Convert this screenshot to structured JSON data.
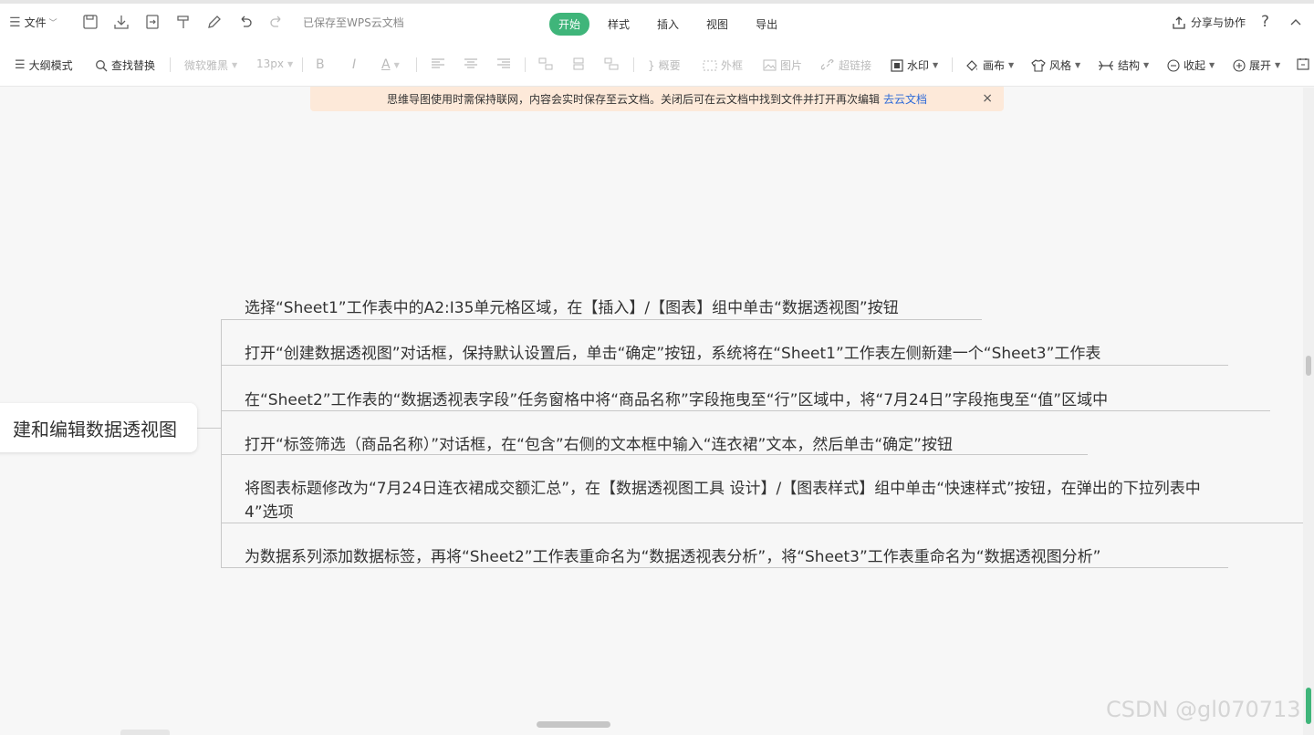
{
  "topbar": {
    "file_label": "文件",
    "saved_status": "已保存至WPS云文档",
    "tabs": [
      {
        "label": "开始",
        "active": true
      },
      {
        "label": "样式",
        "active": false
      },
      {
        "label": "插入",
        "active": false
      },
      {
        "label": "视图",
        "active": false
      },
      {
        "label": "导出",
        "active": false
      }
    ],
    "share_label": "分享与协作",
    "help_symbol": "?"
  },
  "toolbar": {
    "outline_mode": "大纲模式",
    "find_replace": "查找替换",
    "font_family": "微软雅黑",
    "font_size": "13px",
    "bold": "B",
    "italic": "I",
    "font_color": "A",
    "summary": "概要",
    "boundary": "外框",
    "image": "图片",
    "hyperlink": "超链接",
    "watermark": "水印",
    "canvas": "画布",
    "style": "风格",
    "structure": "结构",
    "collapse": "收起",
    "expand": "展开"
  },
  "notice": {
    "text": "思维导图使用时需保持联网，内容会实时保存至云文档。关闭后可在云文档中找到文件并打开再次编辑",
    "link": "去云文档",
    "close": "×"
  },
  "mindmap": {
    "root": "建和编辑数据透视图",
    "children": [
      {
        "text": "选择“Sheet1”工作表中的A2:I35单元格区域，在【插入】/【图表】组中单击“数据透视图”按钮"
      },
      {
        "text": "打开“创建数据透视图”对话框，保持默认设置后，单击“确定”按钮，系统将在“Sheet1”工作表左侧新建一个“Sheet3”工作表"
      },
      {
        "text": "在“Sheet2”工作表的“数据透视表字段”任务窗格中将“商品名称”字段拖曳至“行”区域中，将“7月24日”字段拖曳至“值”区域中"
      },
      {
        "text": "打开“标签筛选（商品名称）”对话框，在“包含”右侧的文本框中输入“连衣裙”文本，然后单击“确定”按钮"
      },
      {
        "text": "将图表标题修改为“7月24日连衣裙成交额汇总”，在【数据透视图工具 设计】/【图表样式】组中单击“快速样式”按钮，在弹出的下拉列表中",
        "text2": "4”选项"
      },
      {
        "text": "为数据系列添加数据标签，再将“Sheet2”工作表重命名为“数据透视表分析”，将“Sheet3”工作表重命名为“数据透视图分析”"
      }
    ]
  },
  "watermark": "CSDN @gl070713"
}
